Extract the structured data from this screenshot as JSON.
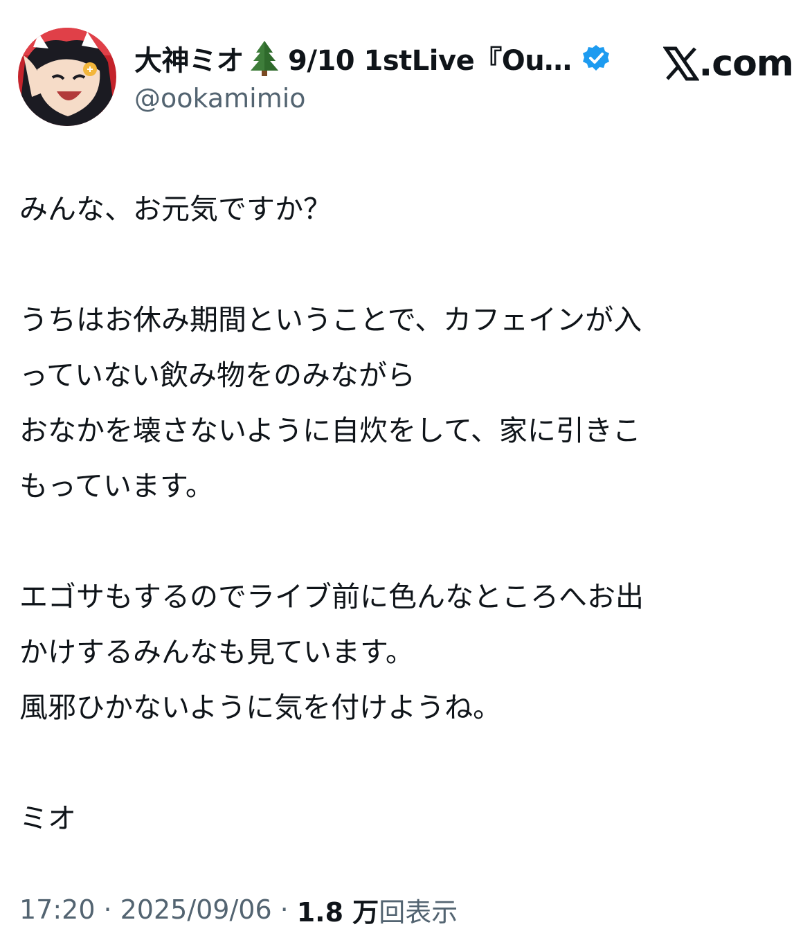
{
  "header": {
    "display_name": "大神ミオ",
    "name_emoji": "tree-emoji-icon",
    "name_suffix": "9/10 1stLive『Ou…",
    "verified": "verified-badge-icon",
    "handle": "@ookamimio",
    "brand_text": ".com",
    "brand_icon": "x-logo-icon"
  },
  "tweet": {
    "paragraphs": [
      [
        "みんな、お元気ですか？"
      ],
      [
        "うちはお休み期間ということで、カフェインが入",
        "っていない飲み物をのみながら",
        "おなかを壊さないように自炊をして、家に引きこ",
        "もっています。"
      ],
      [
        "エゴサもするのでライブ前に色んなところへお出",
        "かけするみんなも見ています。",
        "風邪ひかないように気を付けようね。"
      ],
      [
        "ミオ"
      ]
    ]
  },
  "meta": {
    "time": "17:20",
    "separator": "·",
    "date": "2025/09/06",
    "views_count": "1.8 万",
    "views_label": "回表示"
  },
  "colors": {
    "text": "#0f1419",
    "muted": "#536471",
    "verified": "#1d9bf0",
    "background": "#ffffff"
  }
}
